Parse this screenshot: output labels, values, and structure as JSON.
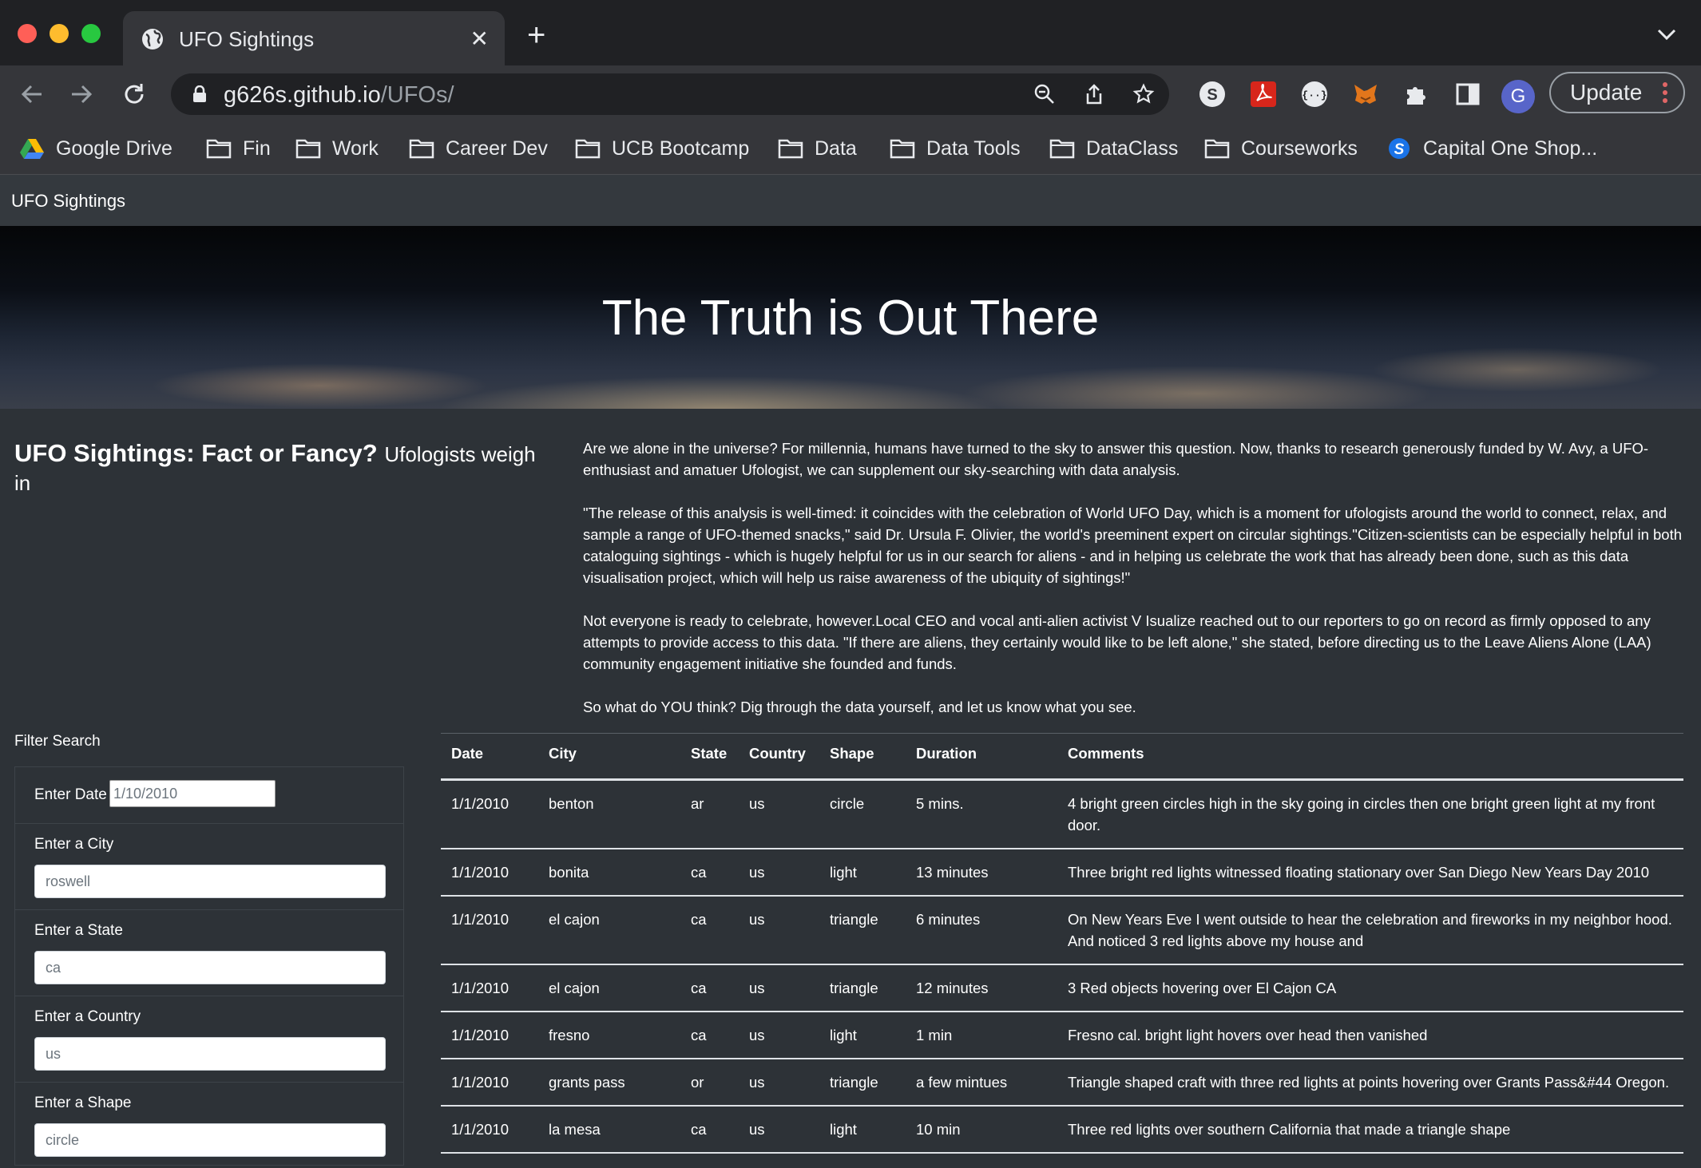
{
  "browser": {
    "tab_title": "UFO Sightings",
    "url_host": "g626s.github.io",
    "url_path": "/UFOs/",
    "profile_initial": "G",
    "update_label": "Update",
    "bookmarks": [
      {
        "label": "Google Drive",
        "icon": "google-drive-icon"
      },
      {
        "label": "Fin",
        "icon": "folder-icon"
      },
      {
        "label": "Work",
        "icon": "folder-icon"
      },
      {
        "label": "Career Dev",
        "icon": "folder-icon"
      },
      {
        "label": "UCB Bootcamp",
        "icon": "folder-icon"
      },
      {
        "label": "Data",
        "icon": "folder-icon"
      },
      {
        "label": "Data Tools",
        "icon": "folder-icon"
      },
      {
        "label": "DataClass",
        "icon": "folder-icon"
      },
      {
        "label": "Courseworks",
        "icon": "folder-icon"
      },
      {
        "label": "Capital One Shop...",
        "icon": "capital-one-shopping-icon"
      }
    ]
  },
  "navbar": {
    "brand": "UFO Sightings"
  },
  "hero": {
    "title": "The Truth is Out There"
  },
  "article": {
    "heading": "UFO Sightings: Fact or Fancy?",
    "subheading": "Ufologists weigh in",
    "paragraphs": [
      "Are we alone in the universe? For millennia, humans have turned to the sky to answer this question. Now, thanks to research generously funded by W. Avy, a UFO-enthusiast and amatuer Ufologist, we can supplement our sky-searching with data analysis.",
      "\"The release of this analysis is well-timed: it coincides with the celebration of World UFO Day, which is a moment for ufologists around the world to connect, relax, and sample a range of UFO-themed snacks,\" said Dr. Ursula F. Olivier, the world's preeminent expert on circular sightings.\"Citizen-scientists can be especially helpful in both cataloguing sightings - which is hugely helpful for us in our search for aliens - and in helping us celebrate the work that has already been done, such as this data visualisation project, which will help us raise awareness of the ubiquity of sightings!\"",
      "Not everyone is ready to celebrate, however.Local CEO and vocal anti-alien activist V Isualize reached out to our reporters to go on record as firmly opposed to any attempts to provide access to this data. \"If there are aliens, they certainly would like to be left alone,\" she stated, before directing us to the Leave Aliens Alone (LAA) community engagement initiative she founded and funds.",
      "So what do YOU think? Dig through the data yourself, and let us know what you see."
    ]
  },
  "filters": {
    "title": "Filter Search",
    "date": {
      "label": "Enter Date",
      "placeholder": "1/10/2010"
    },
    "city": {
      "label": "Enter a City",
      "placeholder": "roswell"
    },
    "state": {
      "label": "Enter a State",
      "placeholder": "ca"
    },
    "country": {
      "label": "Enter a Country",
      "placeholder": "us"
    },
    "shape": {
      "label": "Enter a Shape",
      "placeholder": "circle"
    }
  },
  "table": {
    "headers": [
      "Date",
      "City",
      "State",
      "Country",
      "Shape",
      "Duration",
      "Comments"
    ],
    "rows": [
      [
        "1/1/2010",
        "benton",
        "ar",
        "us",
        "circle",
        "5 mins.",
        "4 bright green circles high in the sky going in circles then one bright green light at my front door."
      ],
      [
        "1/1/2010",
        "bonita",
        "ca",
        "us",
        "light",
        "13 minutes",
        "Three bright red lights witnessed floating stationary over San Diego New Years Day 2010"
      ],
      [
        "1/1/2010",
        "el cajon",
        "ca",
        "us",
        "triangle",
        "6 minutes",
        "On New Years Eve I went outside to hear the celebration and fireworks in my neighbor hood. And noticed 3 red lights above my house and"
      ],
      [
        "1/1/2010",
        "el cajon",
        "ca",
        "us",
        "triangle",
        "12 minutes",
        "3 Red objects hovering over El Cajon CA"
      ],
      [
        "1/1/2010",
        "fresno",
        "ca",
        "us",
        "light",
        "1 min",
        "Fresno cal. bright light hovers over head then vanished"
      ],
      [
        "1/1/2010",
        "grants pass",
        "or",
        "us",
        "triangle",
        "a few mintues",
        "Triangle shaped craft with three red lights at points hovering over Grants Pass&#44 Oregon."
      ],
      [
        "1/1/2010",
        "la mesa",
        "ca",
        "us",
        "light",
        "10 min",
        "Three red lights over southern California that made a triangle shape"
      ]
    ]
  }
}
